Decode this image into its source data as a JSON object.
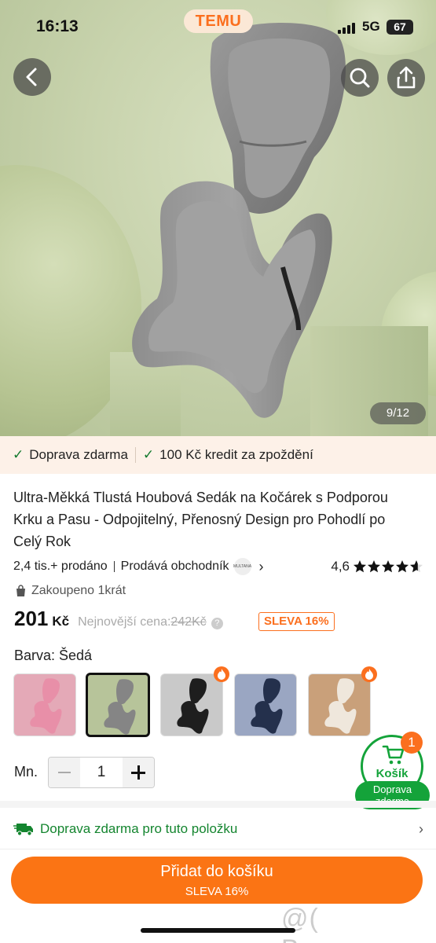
{
  "status_bar": {
    "time": "16:13",
    "network": "5G",
    "battery": "67"
  },
  "app": {
    "brand": "TEMU"
  },
  "gallery": {
    "counter": "9/12"
  },
  "banner": {
    "shipping": "Doprava zdarma",
    "credit": "100 Kč kredit za zpoždění"
  },
  "product": {
    "title": "Ultra-Měkká Tlustá Houbová Sedák na Kočárek s Podporou Krku a Pasu - Odpojitelný, Přenosný Design pro Pohodlí po Celý Rok",
    "sold": "2,4 tis.+ prodáno",
    "seller_label": "Prodává obchodník",
    "seller_logo_text": "MULTANA",
    "rating": "4,6",
    "rating_value": 4.6,
    "bought": "Zakoupeno 1krát",
    "price": "201",
    "currency": "Kč",
    "lowest_label": "Nejnovější cena:",
    "old_price": "242Kč",
    "discount": "SLEVA 16%"
  },
  "variants": {
    "label": "Barva: Šedá",
    "items": [
      {
        "name": "pink",
        "bg": "#e4a9b7",
        "seat": "#e88fa8",
        "hot": false,
        "selected": false
      },
      {
        "name": "grey",
        "bg": "#b7c49a",
        "seat": "#858585",
        "hot": false,
        "selected": true
      },
      {
        "name": "black",
        "bg": "#c9c9c9",
        "seat": "#1e1e1e",
        "hot": true,
        "selected": false
      },
      {
        "name": "navy",
        "bg": "#9aa6c2",
        "seat": "#24304c",
        "hot": false,
        "selected": false
      },
      {
        "name": "beige",
        "bg": "#c9a07a",
        "seat": "#efe7dc",
        "hot": true,
        "selected": false
      }
    ]
  },
  "quantity": {
    "label": "Mn.",
    "value": "1"
  },
  "cart": {
    "count": "1",
    "label": "Košík",
    "shipping_line1": "Doprava",
    "shipping_line2": "zdarma"
  },
  "shipping_row": {
    "text": "Doprava zdarma pro tuto položku"
  },
  "add_to_cart": {
    "label": "Přidat do košíku",
    "sublabel": "SLEVA 16%"
  },
  "watermark": "@( Bazos.cz",
  "colors": {
    "accent": "#fb7414",
    "green": "#14a33a",
    "banner_bg": "#fdf1e8"
  }
}
